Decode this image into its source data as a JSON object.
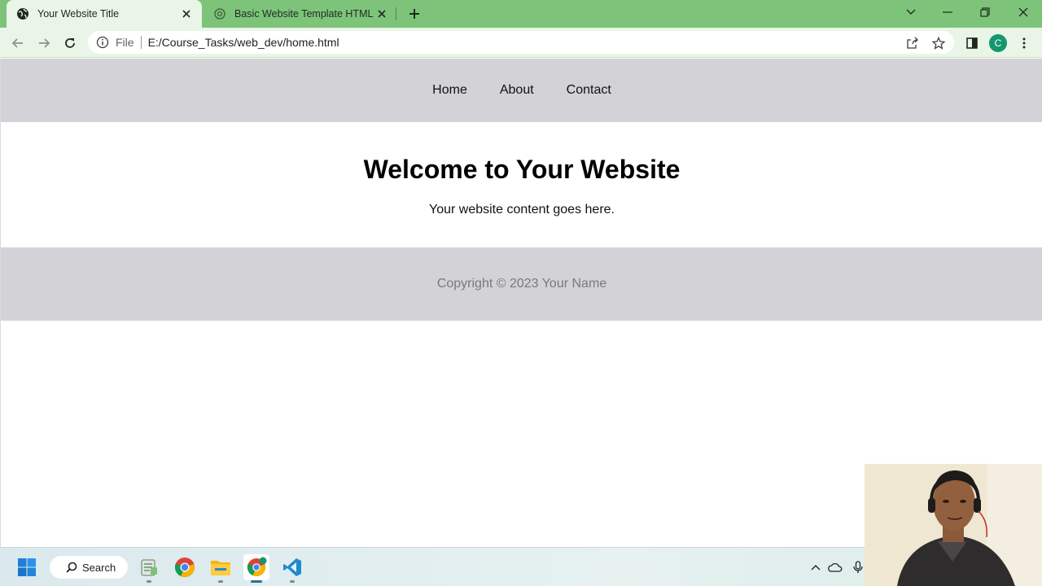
{
  "browser": {
    "tabs": [
      {
        "title": "Your Website Title",
        "active": true
      },
      {
        "title": "Basic Website Template HTML",
        "active": false
      }
    ],
    "address": {
      "scheme": "File",
      "url": "E:/Course_Tasks/web_dev/home.html"
    },
    "profile_initial": "C",
    "accent_color": "#7dc47a"
  },
  "page": {
    "nav": [
      "Home",
      "About",
      "Contact"
    ],
    "heading": "Welcome to Your Website",
    "content": "Your website content goes here.",
    "footer": "Copyright © 2023 Your Name",
    "header_bg": "#d3d2d6"
  },
  "taskbar": {
    "search_label": "Search",
    "apps": [
      "start-icon",
      "notepad-icon",
      "chrome-icon",
      "file-explorer-icon",
      "chrome-profile-icon",
      "vscode-icon"
    ],
    "tray": [
      "chevron-up-icon",
      "onedrive-icon",
      "microphone-icon"
    ]
  }
}
